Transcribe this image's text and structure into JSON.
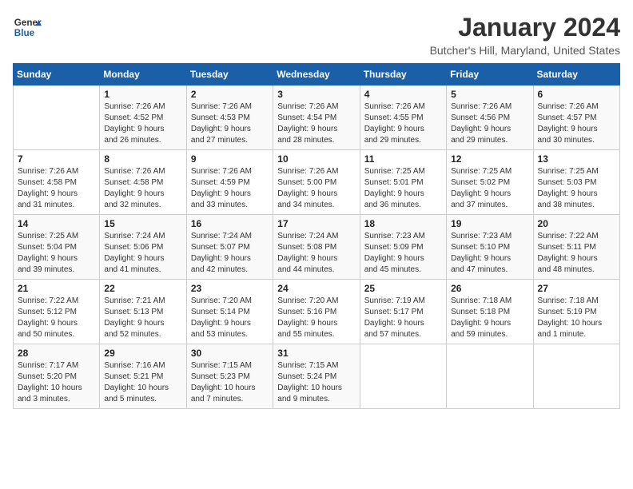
{
  "header": {
    "logo_line1": "General",
    "logo_line2": "Blue",
    "month": "January 2024",
    "location": "Butcher's Hill, Maryland, United States"
  },
  "weekdays": [
    "Sunday",
    "Monday",
    "Tuesday",
    "Wednesday",
    "Thursday",
    "Friday",
    "Saturday"
  ],
  "weeks": [
    [
      {
        "day": "",
        "info": ""
      },
      {
        "day": "1",
        "info": "Sunrise: 7:26 AM\nSunset: 4:52 PM\nDaylight: 9 hours\nand 26 minutes."
      },
      {
        "day": "2",
        "info": "Sunrise: 7:26 AM\nSunset: 4:53 PM\nDaylight: 9 hours\nand 27 minutes."
      },
      {
        "day": "3",
        "info": "Sunrise: 7:26 AM\nSunset: 4:54 PM\nDaylight: 9 hours\nand 28 minutes."
      },
      {
        "day": "4",
        "info": "Sunrise: 7:26 AM\nSunset: 4:55 PM\nDaylight: 9 hours\nand 29 minutes."
      },
      {
        "day": "5",
        "info": "Sunrise: 7:26 AM\nSunset: 4:56 PM\nDaylight: 9 hours\nand 29 minutes."
      },
      {
        "day": "6",
        "info": "Sunrise: 7:26 AM\nSunset: 4:57 PM\nDaylight: 9 hours\nand 30 minutes."
      }
    ],
    [
      {
        "day": "7",
        "info": "Sunrise: 7:26 AM\nSunset: 4:58 PM\nDaylight: 9 hours\nand 31 minutes."
      },
      {
        "day": "8",
        "info": "Sunrise: 7:26 AM\nSunset: 4:58 PM\nDaylight: 9 hours\nand 32 minutes."
      },
      {
        "day": "9",
        "info": "Sunrise: 7:26 AM\nSunset: 4:59 PM\nDaylight: 9 hours\nand 33 minutes."
      },
      {
        "day": "10",
        "info": "Sunrise: 7:26 AM\nSunset: 5:00 PM\nDaylight: 9 hours\nand 34 minutes."
      },
      {
        "day": "11",
        "info": "Sunrise: 7:25 AM\nSunset: 5:01 PM\nDaylight: 9 hours\nand 36 minutes."
      },
      {
        "day": "12",
        "info": "Sunrise: 7:25 AM\nSunset: 5:02 PM\nDaylight: 9 hours\nand 37 minutes."
      },
      {
        "day": "13",
        "info": "Sunrise: 7:25 AM\nSunset: 5:03 PM\nDaylight: 9 hours\nand 38 minutes."
      }
    ],
    [
      {
        "day": "14",
        "info": "Sunrise: 7:25 AM\nSunset: 5:04 PM\nDaylight: 9 hours\nand 39 minutes."
      },
      {
        "day": "15",
        "info": "Sunrise: 7:24 AM\nSunset: 5:06 PM\nDaylight: 9 hours\nand 41 minutes."
      },
      {
        "day": "16",
        "info": "Sunrise: 7:24 AM\nSunset: 5:07 PM\nDaylight: 9 hours\nand 42 minutes."
      },
      {
        "day": "17",
        "info": "Sunrise: 7:24 AM\nSunset: 5:08 PM\nDaylight: 9 hours\nand 44 minutes."
      },
      {
        "day": "18",
        "info": "Sunrise: 7:23 AM\nSunset: 5:09 PM\nDaylight: 9 hours\nand 45 minutes."
      },
      {
        "day": "19",
        "info": "Sunrise: 7:23 AM\nSunset: 5:10 PM\nDaylight: 9 hours\nand 47 minutes."
      },
      {
        "day": "20",
        "info": "Sunrise: 7:22 AM\nSunset: 5:11 PM\nDaylight: 9 hours\nand 48 minutes."
      }
    ],
    [
      {
        "day": "21",
        "info": "Sunrise: 7:22 AM\nSunset: 5:12 PM\nDaylight: 9 hours\nand 50 minutes."
      },
      {
        "day": "22",
        "info": "Sunrise: 7:21 AM\nSunset: 5:13 PM\nDaylight: 9 hours\nand 52 minutes."
      },
      {
        "day": "23",
        "info": "Sunrise: 7:20 AM\nSunset: 5:14 PM\nDaylight: 9 hours\nand 53 minutes."
      },
      {
        "day": "24",
        "info": "Sunrise: 7:20 AM\nSunset: 5:16 PM\nDaylight: 9 hours\nand 55 minutes."
      },
      {
        "day": "25",
        "info": "Sunrise: 7:19 AM\nSunset: 5:17 PM\nDaylight: 9 hours\nand 57 minutes."
      },
      {
        "day": "26",
        "info": "Sunrise: 7:18 AM\nSunset: 5:18 PM\nDaylight: 9 hours\nand 59 minutes."
      },
      {
        "day": "27",
        "info": "Sunrise: 7:18 AM\nSunset: 5:19 PM\nDaylight: 10 hours\nand 1 minute."
      }
    ],
    [
      {
        "day": "28",
        "info": "Sunrise: 7:17 AM\nSunset: 5:20 PM\nDaylight: 10 hours\nand 3 minutes."
      },
      {
        "day": "29",
        "info": "Sunrise: 7:16 AM\nSunset: 5:21 PM\nDaylight: 10 hours\nand 5 minutes."
      },
      {
        "day": "30",
        "info": "Sunrise: 7:15 AM\nSunset: 5:23 PM\nDaylight: 10 hours\nand 7 minutes."
      },
      {
        "day": "31",
        "info": "Sunrise: 7:15 AM\nSunset: 5:24 PM\nDaylight: 10 hours\nand 9 minutes."
      },
      {
        "day": "",
        "info": ""
      },
      {
        "day": "",
        "info": ""
      },
      {
        "day": "",
        "info": ""
      }
    ]
  ]
}
